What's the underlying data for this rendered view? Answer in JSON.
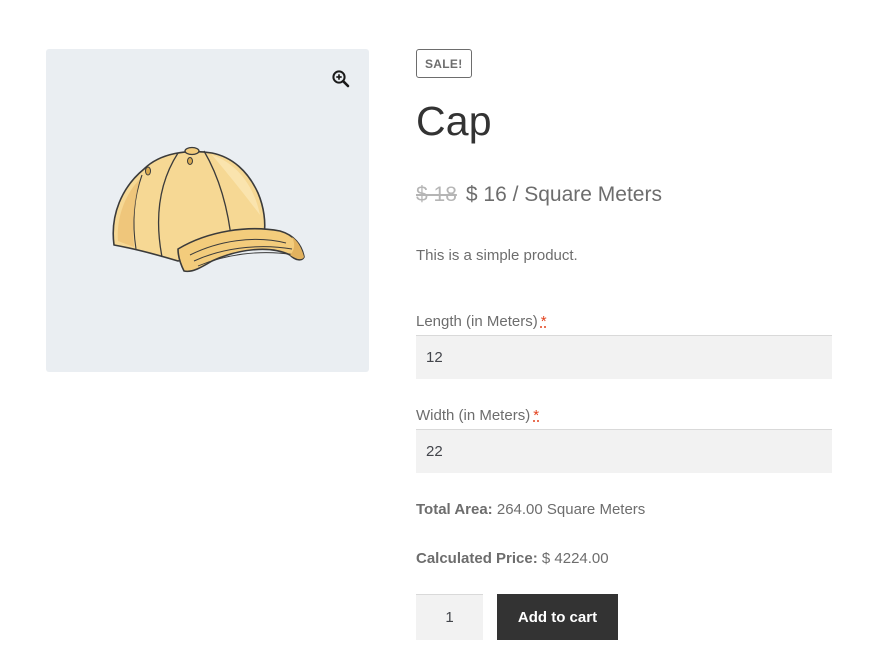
{
  "gallery": {
    "zoom_icon": "magnifier-plus-icon",
    "image": "baseball-cap-illustration",
    "background_color": "#eaeef2",
    "cap_color": "#f2cf86"
  },
  "product": {
    "badge": "SALE!",
    "title": "Cap",
    "price_old": "$ 18",
    "price_new": "$ 16 / Square Meters",
    "description": "This is a simple product."
  },
  "fields": {
    "length_label": "Length (in Meters)",
    "length_value": "12",
    "width_label": "Width (in Meters)",
    "width_value": "22",
    "required_marker": "*"
  },
  "totals": {
    "area_label": "Total Area:",
    "area_value": "264.00 Square Meters",
    "price_label": "Calculated Price:",
    "price_value": "$ 4224.00"
  },
  "cart": {
    "quantity": "1",
    "button_label": "Add to cart",
    "button_color": "#333333"
  }
}
